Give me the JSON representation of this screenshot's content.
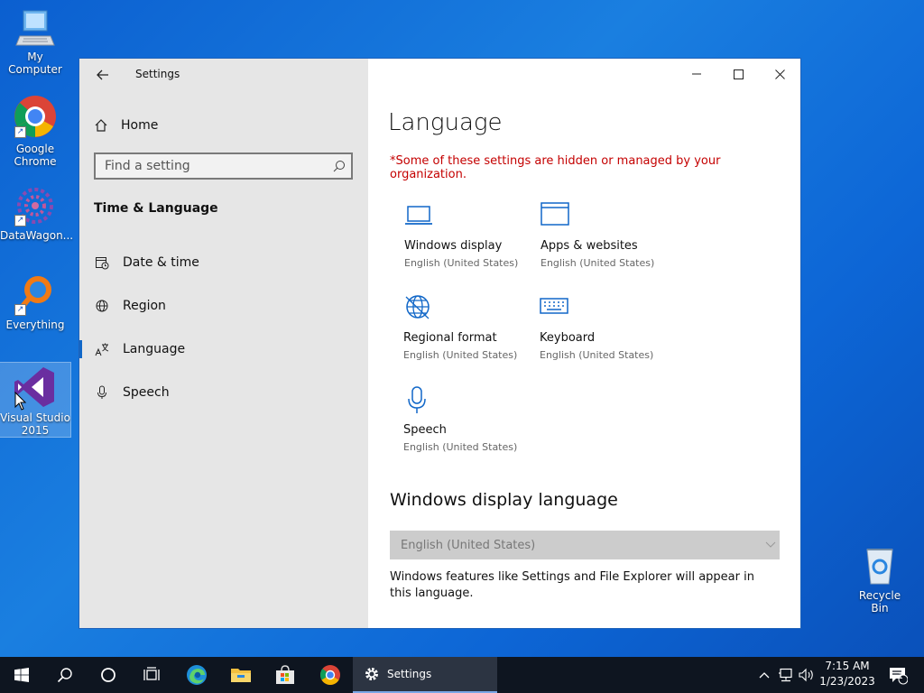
{
  "desktop": {
    "icons": [
      {
        "label": "My Computer"
      },
      {
        "label": "Google Chrome"
      },
      {
        "label": "DataWagon..."
      },
      {
        "label": "Everything"
      },
      {
        "label": "Visual Studio 2015"
      }
    ],
    "recycle_bin": "Recycle Bin"
  },
  "window": {
    "title": "Settings",
    "sidebar": {
      "home": "Home",
      "search_placeholder": "Find a setting",
      "section": "Time & Language",
      "items": [
        {
          "label": "Date & time",
          "icon": "calendar-clock-icon"
        },
        {
          "label": "Region",
          "icon": "globe-icon"
        },
        {
          "label": "Language",
          "icon": "language-icon",
          "active": true
        },
        {
          "label": "Speech",
          "icon": "microphone-icon"
        }
      ]
    },
    "main": {
      "title": "Language",
      "warning": "*Some of these settings are hidden or managed by your organization.",
      "tiles": [
        {
          "title": "Windows display",
          "sub": "English (United States)",
          "icon": "laptop-icon"
        },
        {
          "title": "Apps & websites",
          "sub": "English (United States)",
          "icon": "window-icon"
        },
        {
          "title": "Regional format",
          "sub": "English (United States)",
          "icon": "globe-icon"
        },
        {
          "title": "Keyboard",
          "sub": "English (United States)",
          "icon": "keyboard-icon"
        },
        {
          "title": "Speech",
          "sub": "English (United States)",
          "icon": "microphone-icon"
        }
      ],
      "display_language_heading": "Windows display language",
      "display_language_value": "English (United States)",
      "description": "Windows features like Settings and File Explorer will appear in this language."
    }
  },
  "taskbar": {
    "active_app": "Settings",
    "time": "7:15 AM",
    "date": "1/23/2023",
    "notification_count": "1"
  },
  "colors": {
    "accent": "#1167c8",
    "warning": "#c40000",
    "sidebar_bg": "#e6e6e6"
  }
}
